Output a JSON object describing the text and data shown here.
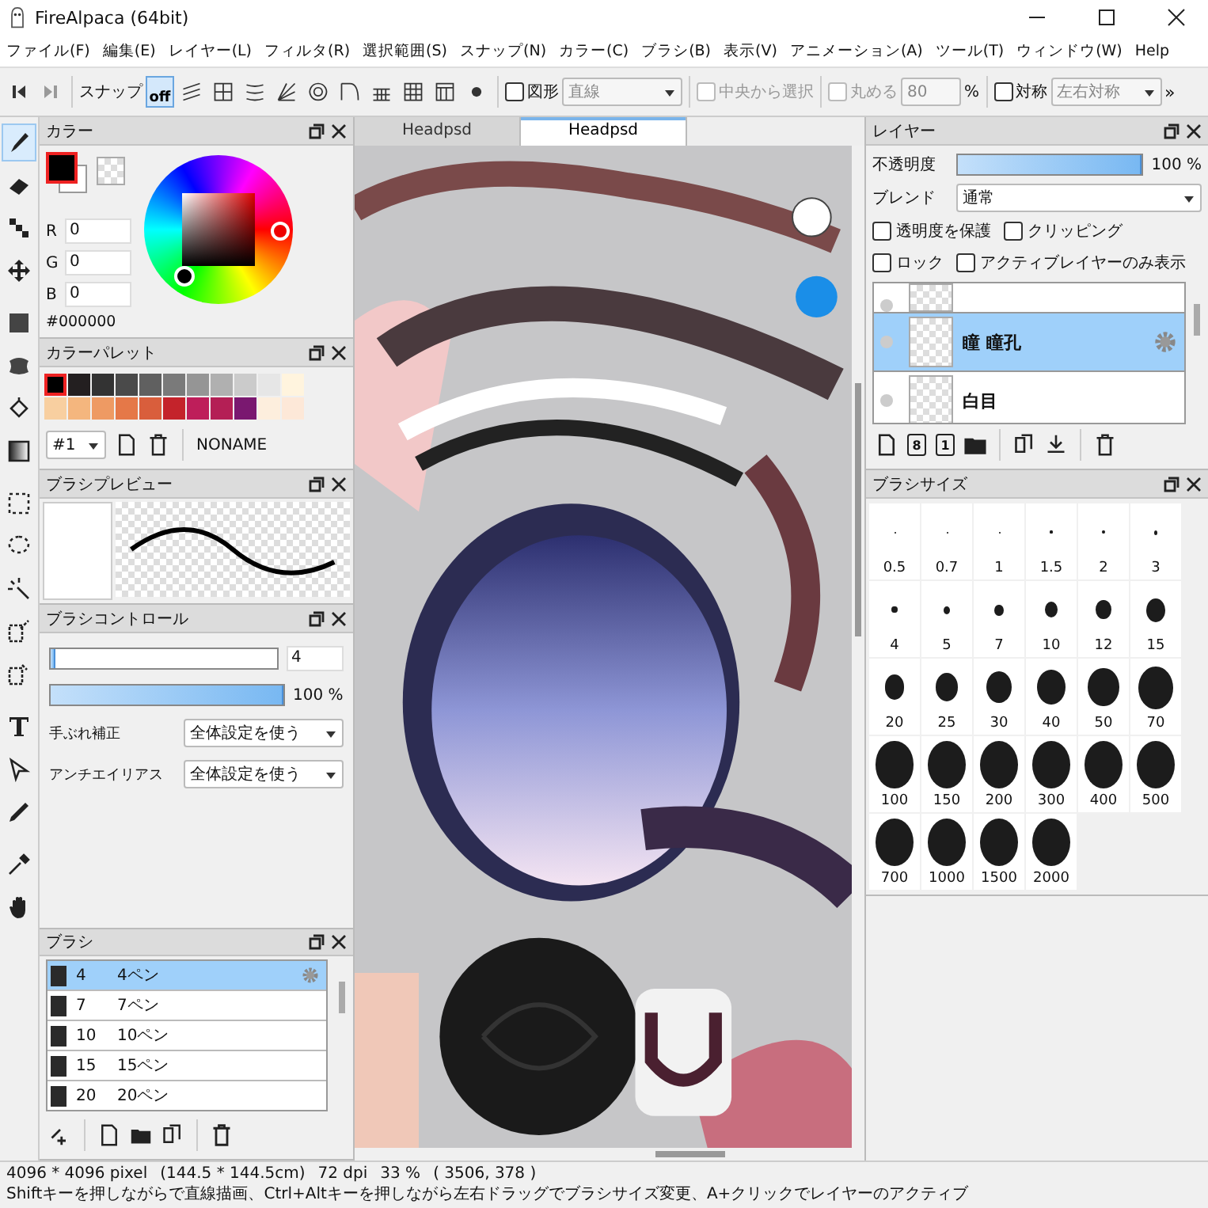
{
  "window": {
    "title": "FireAlpaca (64bit)"
  },
  "menu": [
    "ファイル(F)",
    "編集(E)",
    "レイヤー(L)",
    "フィルタ(R)",
    "選択範囲(S)",
    "スナップ(N)",
    "カラー(C)",
    "ブラシ(B)",
    "表示(V)",
    "アニメーション(A)",
    "ツール(T)",
    "ウィンドウ(W)",
    "Help"
  ],
  "toolbar": {
    "snap_label": "スナップ",
    "snap_buttons": [
      {
        "kind": "off",
        "label": "off",
        "selected": true
      },
      {
        "kind": "parallel",
        "selected": false
      },
      {
        "kind": "grid",
        "selected": false
      },
      {
        "kind": "parallel-curve",
        "selected": false
      },
      {
        "kind": "radial",
        "selected": false
      },
      {
        "kind": "concentric",
        "selected": false
      },
      {
        "kind": "curve",
        "selected": false
      },
      {
        "kind": "perspective-1",
        "selected": false
      },
      {
        "kind": "perspective-2",
        "selected": false
      },
      {
        "kind": "perspective-3",
        "selected": false
      },
      {
        "kind": "dot",
        "selected": false
      }
    ],
    "shape": {
      "label": "図形",
      "checked": false,
      "value": "直線"
    },
    "center_select": {
      "label": "中央から選択",
      "checked": false,
      "disabled": true
    },
    "round": {
      "label": "丸める",
      "checked": false,
      "disabled": true,
      "value": "80",
      "unit": "%"
    },
    "symmetry": {
      "label": "対称",
      "checked": false,
      "value": "左右対称"
    },
    "more": "»"
  },
  "tools": [
    {
      "kind": "brush",
      "selected": true
    },
    {
      "kind": "eraser",
      "selected": false
    },
    {
      "kind": "dot",
      "selected": false
    },
    {
      "kind": "move",
      "selected": false
    },
    {
      "kind": "fill",
      "selected": false
    },
    {
      "kind": "blur",
      "selected": false
    },
    {
      "kind": "bucket",
      "selected": false
    },
    {
      "kind": "gradient",
      "selected": false
    },
    {
      "kind": "select",
      "selected": false
    },
    {
      "kind": "lasso",
      "selected": false
    },
    {
      "kind": "wand",
      "selected": false
    },
    {
      "kind": "select-pen",
      "selected": false
    },
    {
      "kind": "select-eraser",
      "selected": false
    },
    {
      "kind": "text",
      "selected": false
    },
    {
      "kind": "pointer",
      "selected": false
    },
    {
      "kind": "pen",
      "selected": false
    },
    {
      "kind": "eyedropper",
      "selected": false
    },
    {
      "kind": "hand",
      "selected": false
    }
  ],
  "color_panel": {
    "title": "カラー",
    "r_label": "R",
    "r": "0",
    "g_label": "G",
    "g": "0",
    "b_label": "B",
    "b": "0",
    "hex": "#000000"
  },
  "palette_panel": {
    "title": "カラーパレット",
    "palette": "#1",
    "name": "NONAME",
    "swatches": [
      {
        "color": "#000000",
        "selected": true
      },
      {
        "color": "#231f20",
        "selected": false
      },
      {
        "color": "#333333",
        "selected": false
      },
      {
        "color": "#4a4a4a",
        "selected": false
      },
      {
        "color": "#606060",
        "selected": false
      },
      {
        "color": "#7a7a7a",
        "selected": false
      },
      {
        "color": "#959595",
        "selected": false
      },
      {
        "color": "#b0b0b0",
        "selected": false
      },
      {
        "color": "#cbcbcb",
        "selected": false
      },
      {
        "color": "#e6e6e6",
        "selected": false
      },
      {
        "color": "#fff4de",
        "selected": false
      },
      {
        "color": "#f8cfa0",
        "selected": false
      },
      {
        "color": "#f4b67e",
        "selected": false
      },
      {
        "color": "#ee9a63",
        "selected": false
      },
      {
        "color": "#e57848",
        "selected": false
      },
      {
        "color": "#d95e3c",
        "selected": false
      },
      {
        "color": "#c4232b",
        "selected": false
      },
      {
        "color": "#be1e5a",
        "selected": false
      },
      {
        "color": "#b41f55",
        "selected": false
      },
      {
        "color": "#7a1870",
        "selected": false
      },
      {
        "color": "#fdeedd",
        "selected": false
      },
      {
        "color": "#fde8d8",
        "selected": false
      }
    ]
  },
  "brush_preview_panel": {
    "title": "ブラシプレビュー"
  },
  "brush_control_panel": {
    "title": "ブラシコントロール",
    "size": {
      "level": 0.02,
      "value": "4"
    },
    "opacity": {
      "level": 1,
      "reading": "100 %"
    },
    "stabilizer": {
      "label": "手ぶれ補正",
      "value": "全体設定を使う"
    },
    "antialias": {
      "label": "アンチエイリアス",
      "value": "全体設定を使う"
    }
  },
  "brush_panel": {
    "title": "ブラシ",
    "items": [
      {
        "size": "4",
        "name": "4ペン",
        "selected": true
      },
      {
        "size": "7",
        "name": "7ペン",
        "selected": false
      },
      {
        "size": "10",
        "name": "10ペン",
        "selected": false
      },
      {
        "size": "15",
        "name": "15ペン",
        "selected": false
      },
      {
        "size": "20",
        "name": "20ペン",
        "selected": false
      }
    ]
  },
  "tabs": [
    {
      "label": "Headpsd",
      "selected": false
    },
    {
      "label": "Headpsd",
      "selected": true
    }
  ],
  "layer_panel": {
    "title": "レイヤー",
    "opacity": {
      "label": "不透明度",
      "level": 1,
      "reading": "100 %"
    },
    "blend": {
      "label": "ブレンド",
      "value": "通常"
    },
    "options": [
      {
        "label": "透明度を保護",
        "checked": false
      },
      {
        "label": "クリッピング",
        "checked": false
      },
      {
        "label": "ロック",
        "checked": false
      },
      {
        "label": "アクティブレイヤーのみ表示",
        "checked": false
      }
    ],
    "layers": [
      {
        "selected": false
      },
      {
        "name": "瞳 瞳孔",
        "selected": true
      },
      {
        "name": "白目",
        "selected": false
      }
    ],
    "buttons": [
      {
        "kind": "new"
      },
      {
        "kind": "new-8bit",
        "label": "8"
      },
      {
        "kind": "new-1bit",
        "label": "1"
      },
      {
        "kind": "folder"
      },
      {
        "kind": "duplicate"
      },
      {
        "kind": "merge-down"
      },
      {
        "kind": "delete"
      }
    ]
  },
  "brush_size_panel": {
    "title": "ブラシサイズ",
    "sizes": [
      "0.5",
      "0.7",
      "1",
      "1.5",
      "2",
      "3",
      "4",
      "5",
      "7",
      "10",
      "12",
      "15",
      "20",
      "25",
      "30",
      "40",
      "50",
      "70",
      "100",
      "150",
      "200",
      "300",
      "400",
      "500",
      "700",
      "1000",
      "1500",
      "2000"
    ]
  },
  "status_bar": {
    "size": "4096 * 4096 pixel",
    "physical": "(144.5 * 144.5cm)",
    "dpi": "72 dpi",
    "zoom": "33 %",
    "position": "( 3506, 378 )",
    "hint": "Shiftキーを押しながらで直線描画、Ctrl+Altキーを押しながら左右ドラッグでブラシサイズ変更、A+クリックでレイヤーのアクティブ"
  }
}
